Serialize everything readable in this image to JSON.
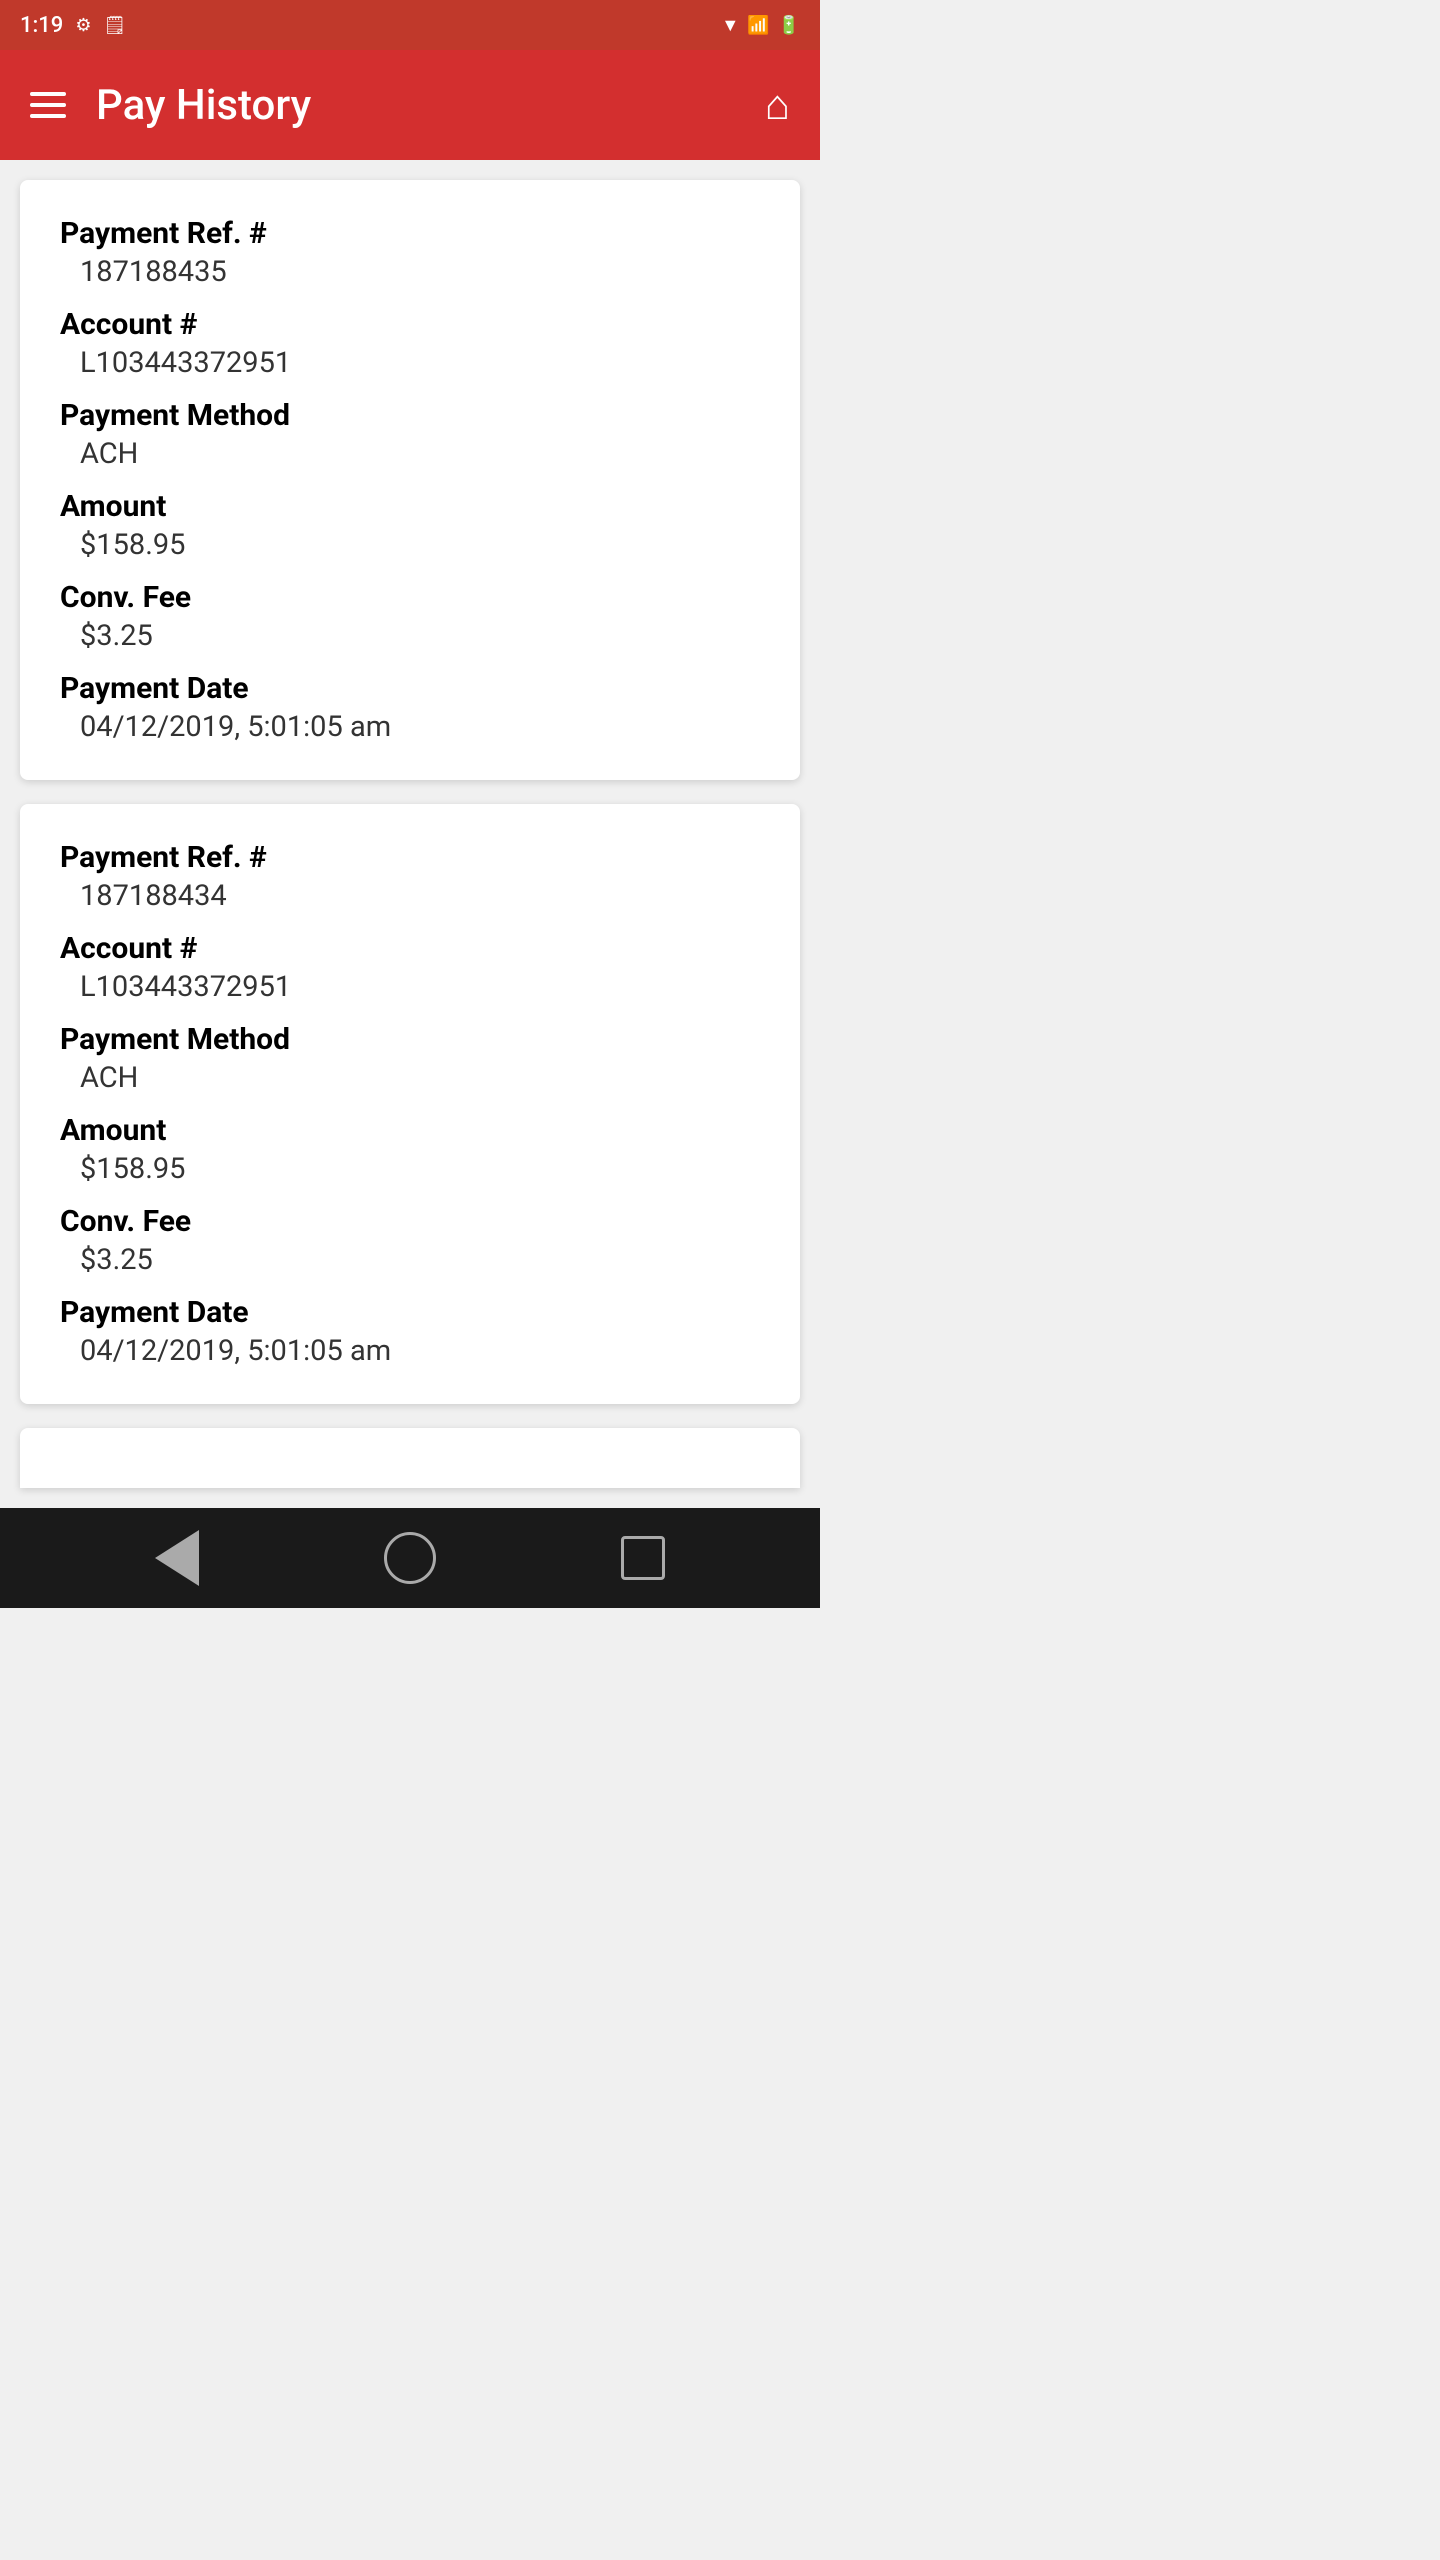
{
  "statusBar": {
    "time": "1:19",
    "icons": [
      "settings",
      "clipboard",
      "wifi",
      "signal",
      "battery"
    ]
  },
  "appBar": {
    "title": "Pay History",
    "menuIcon": "hamburger-icon",
    "homeIcon": "home-icon"
  },
  "payments": [
    {
      "id": "payment-1",
      "paymentRefLabel": "Payment Ref. #",
      "paymentRefValue": "187188435",
      "accountLabel": "Account #",
      "accountValue": "L103443372951",
      "paymentMethodLabel": "Payment Method",
      "paymentMethodValue": "ACH",
      "amountLabel": "Amount",
      "amountValue": "$158.95",
      "convFeeLabel": "Conv. Fee",
      "convFeeValue": "$3.25",
      "paymentDateLabel": "Payment Date",
      "paymentDateValue": "04/12/2019, 5:01:05 am"
    },
    {
      "id": "payment-2",
      "paymentRefLabel": "Payment Ref. #",
      "paymentRefValue": "187188434",
      "accountLabel": "Account #",
      "accountValue": "L103443372951",
      "paymentMethodLabel": "Payment Method",
      "paymentMethodValue": "ACH",
      "amountLabel": "Amount",
      "amountValue": "$158.95",
      "convFeeLabel": "Conv. Fee",
      "convFeeValue": "$3.25",
      "paymentDateLabel": "Payment Date",
      "paymentDateValue": "04/12/2019, 5:01:05 am"
    }
  ],
  "bottomNav": {
    "backLabel": "back",
    "homeLabel": "home",
    "recentLabel": "recent"
  }
}
